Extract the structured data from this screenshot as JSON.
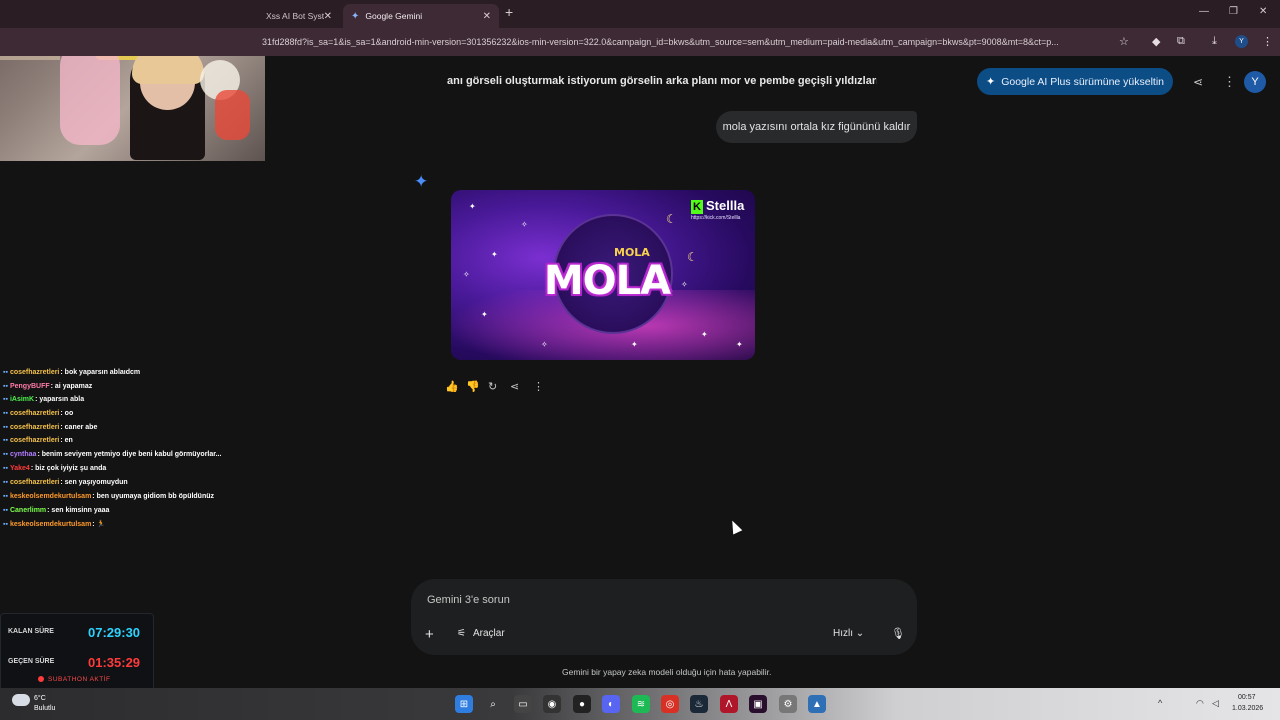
{
  "browser": {
    "tabs": [
      {
        "title": "Xss AI Bot Syst",
        "active": false
      },
      {
        "title": "Google Gemini",
        "active": true
      }
    ],
    "url": "31fd288fd?is_sa=1&is_sa=1&android-min-version=301356232&ios-min-version=322.0&campaign_id=bkws&utm_source=sem&utm_medium=paid-media&utm_campaign=bkws&pt=9008&mt=8&ct=p...",
    "profile_initial": "Y"
  },
  "gemini": {
    "chat_title": "anı görseli oluşturmak istiyorum görselin arka planı mor ve pembe geçişli yıldızların olı",
    "upgrade_label": "Google AI Plus sürümüne yükseltin",
    "avatar_initial": "Y",
    "user_message": "mola yazısını ortala kız figününü kaldır",
    "image": {
      "small_text": "MOLA",
      "big_text": "MOLA",
      "brand": "Stellla",
      "brand_letter": "K",
      "brand_url": "https://kick.com/Stellla"
    },
    "prompt_placeholder": "Gemini 3'e sorun",
    "tools_label": "Araçlar",
    "mode_label": "Hızlı",
    "disclaimer": "Gemini bir yapay zeka modeli olduğu için hata yapabilir."
  },
  "chat": [
    {
      "user": "cosefhazretleri",
      "color": "#f5c04a",
      "message": ": bok yaparsın ablaıdcm"
    },
    {
      "user": "PengyBUFF",
      "color": "#ff7aa8",
      "message": ": ai yapamaz"
    },
    {
      "user": "iAsimK",
      "color": "#4cf04c",
      "message": ": yaparsın abla"
    },
    {
      "user": "cosefhazretleri",
      "color": "#f5c04a",
      "message": ": oo"
    },
    {
      "user": "cosefhazretleri",
      "color": "#f5c04a",
      "message": ": caner abe"
    },
    {
      "user": "cosefhazretleri",
      "color": "#f5c04a",
      "message": ": en"
    },
    {
      "user": "cynthaa",
      "color": "#b07cff",
      "message": ": benim seviyem yetmiyo diye beni kabul görmüyorlar..."
    },
    {
      "user": "Yake4",
      "color": "#ff3a3a",
      "message": ": biz çok iyiyiz şu anda"
    },
    {
      "user": "cosefhazretleri",
      "color": "#f5c04a",
      "message": ": sen yaşıyomuydun"
    },
    {
      "user": "keskeolsemdekurtulsam",
      "color": "#ff9a2a",
      "message": ": ben uyumaya gidiom bb öpüldünüz"
    },
    {
      "user": "Canerlimm",
      "color": "#7cff4c",
      "message": ": sen kimsinn yaaa"
    },
    {
      "user": "keskeolsemdekurtulsam",
      "color": "#ff9a2a",
      "message": ": 🏃"
    }
  ],
  "timer": {
    "remaining_label": "KALAN SÜRE",
    "remaining_value": "07:29:30",
    "elapsed_label": "GEÇEN SÜRE",
    "elapsed_value": "01:35:29",
    "status": "SUBATHON AKTİF"
  },
  "taskbar": {
    "temperature": "6°C",
    "weather": "Bulutlu",
    "time": "00:57",
    "date": "1.03.2026"
  },
  "colors": {
    "accent_blue": "#0d4d86",
    "remaining_color": "#2ed3ff",
    "elapsed_color": "#ff3b3b"
  }
}
